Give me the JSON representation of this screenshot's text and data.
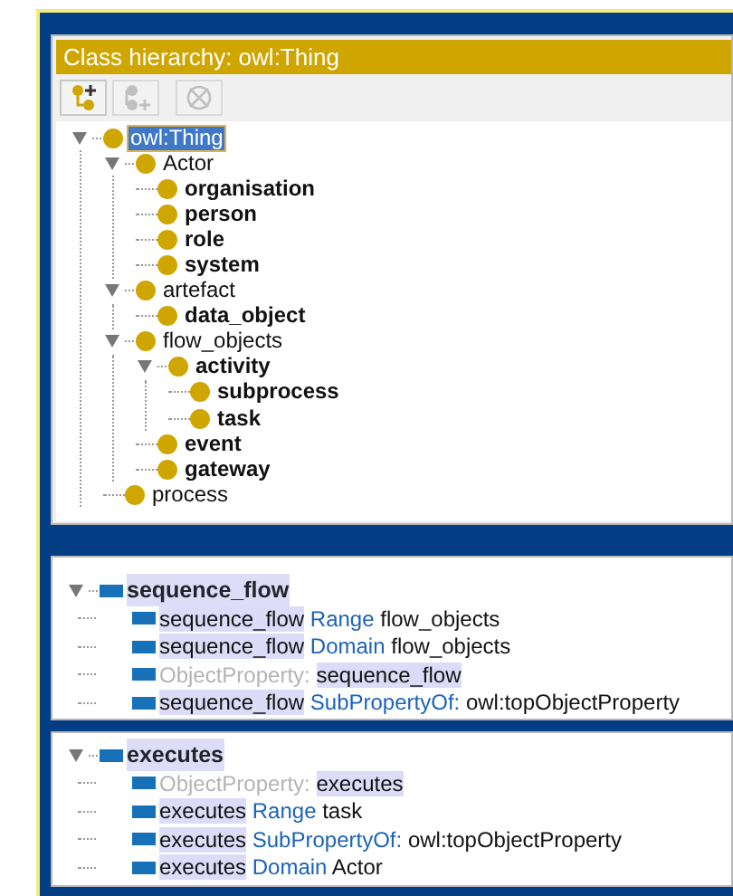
{
  "panel_title": "Class hierarchy: owl:Thing",
  "toolbar": [
    {
      "kind": "add-subclass",
      "disabled": false
    },
    {
      "kind": "add-sibling",
      "disabled": true
    },
    {
      "kind": "delete",
      "disabled": true
    }
  ],
  "class_tree": [
    {
      "label": "owl:Thing",
      "bold": false,
      "selected": true,
      "expanded": true,
      "children": [
        {
          "label": "Actor",
          "bold": false,
          "selected": false,
          "expanded": true,
          "children": [
            {
              "label": "organisation",
              "bold": true,
              "selected": false
            },
            {
              "label": "person",
              "bold": true,
              "selected": false
            },
            {
              "label": "role",
              "bold": true,
              "selected": false
            },
            {
              "label": "system",
              "bold": true,
              "selected": false
            }
          ]
        },
        {
          "label": "artefact",
          "bold": false,
          "selected": false,
          "expanded": true,
          "children": [
            {
              "label": "data_object",
              "bold": true,
              "selected": false
            }
          ]
        },
        {
          "label": "flow_objects",
          "bold": false,
          "selected": false,
          "expanded": true,
          "children": [
            {
              "label": "activity",
              "bold": true,
              "selected": false,
              "expanded": true,
              "children": [
                {
                  "label": "subprocess",
                  "bold": true,
                  "selected": false
                },
                {
                  "label": "task",
                  "bold": true,
                  "selected": false
                }
              ]
            },
            {
              "label": "event",
              "bold": true,
              "selected": false
            },
            {
              "label": "gateway",
              "bold": true,
              "selected": false
            }
          ]
        },
        {
          "label": "process",
          "bold": false,
          "selected": false
        }
      ]
    }
  ],
  "properties": [
    {
      "name": "sequence_flow",
      "expanded": true,
      "axioms": [
        [
          {
            "kind": "entity",
            "text": "sequence_flow"
          },
          {
            "kind": "keyword",
            "text": "Range"
          },
          {
            "kind": "plain",
            "text": "flow_objects"
          }
        ],
        [
          {
            "kind": "entity",
            "text": "sequence_flow"
          },
          {
            "kind": "keyword",
            "text": "Domain"
          },
          {
            "kind": "plain",
            "text": "flow_objects"
          }
        ],
        [
          {
            "kind": "muted",
            "text": "ObjectProperty:"
          },
          {
            "kind": "entity",
            "text": "sequence_flow"
          }
        ],
        [
          {
            "kind": "entity",
            "text": "sequence_flow"
          },
          {
            "kind": "keyword",
            "text": "SubPropertyOf:"
          },
          {
            "kind": "plain",
            "text": "owl:topObjectProperty"
          }
        ]
      ]
    },
    {
      "name": "executes",
      "expanded": true,
      "axioms": [
        [
          {
            "kind": "muted",
            "text": "ObjectProperty:"
          },
          {
            "kind": "entity",
            "text": "executes"
          }
        ],
        [
          {
            "kind": "entity",
            "text": "executes"
          },
          {
            "kind": "keyword",
            "text": "Range"
          },
          {
            "kind": "plain",
            "text": "task"
          }
        ],
        [
          {
            "kind": "entity",
            "text": "executes"
          },
          {
            "kind": "keyword",
            "text": "SubPropertyOf:"
          },
          {
            "kind": "plain",
            "text": "owl:topObjectProperty"
          }
        ],
        [
          {
            "kind": "entity",
            "text": "executes"
          },
          {
            "kind": "keyword",
            "text": "Domain"
          },
          {
            "kind": "plain",
            "text": "Actor"
          }
        ]
      ]
    }
  ]
}
